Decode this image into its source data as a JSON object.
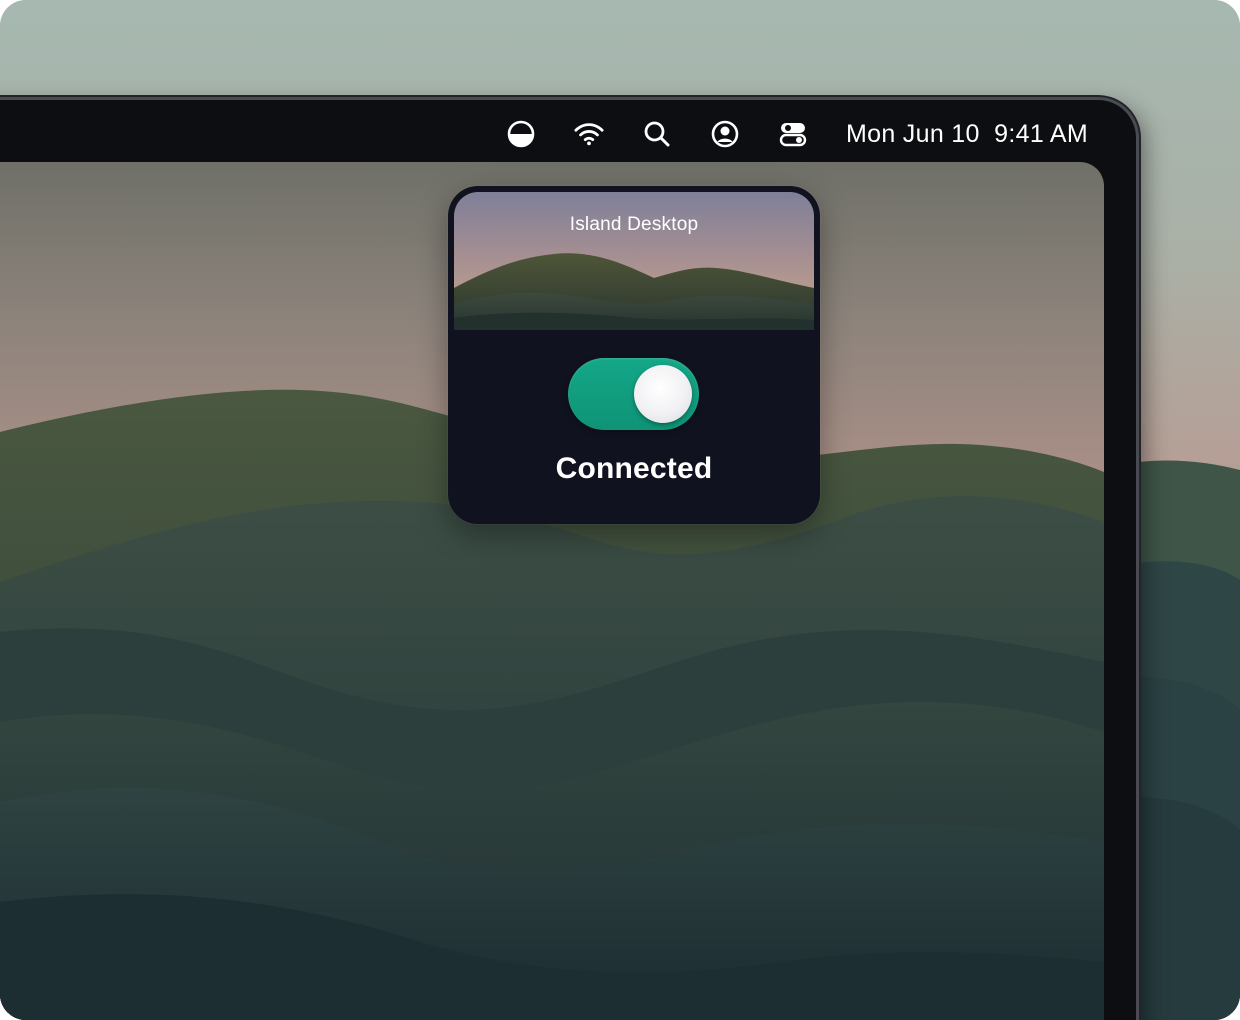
{
  "menubar": {
    "icons": [
      "appearance-icon",
      "wifi-icon",
      "search-icon",
      "user-icon",
      "control-center-icon"
    ],
    "date": "Mon Jun 10",
    "time": "9:41 AM"
  },
  "island": {
    "title": "Island Desktop",
    "toggle_on": true,
    "status": "Connected"
  },
  "colors": {
    "toggle_on": "#12a082",
    "island_bg": "#10131f",
    "bezel": "#0d0e12"
  }
}
